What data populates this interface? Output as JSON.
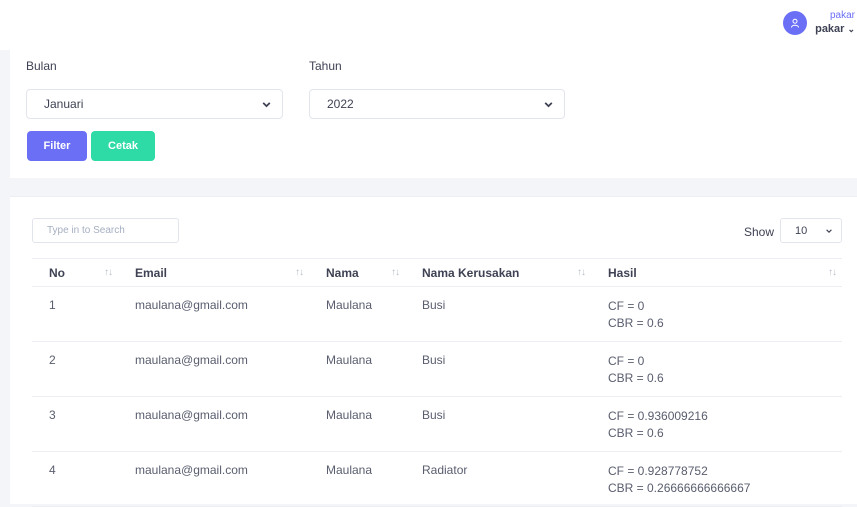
{
  "user": {
    "role": "pakar",
    "name": "pakar"
  },
  "filter": {
    "bulan_label": "Bulan",
    "bulan_value": "Januari",
    "tahun_label": "Tahun",
    "tahun_value": "2022",
    "filter_button": "Filter",
    "cetak_button": "Cetak"
  },
  "table_controls": {
    "search_placeholder": "Type in to Search",
    "show_label": "Show",
    "page_length": "10"
  },
  "table": {
    "headers": [
      "No",
      "Email",
      "Nama",
      "Nama Kerusakan",
      "Hasil"
    ],
    "rows": [
      {
        "no": "1",
        "email": "maulana@gmail.com",
        "nama": "Maulana",
        "kerusakan": "Busi",
        "cf": "CF = 0",
        "cbr": "CBR = 0.6"
      },
      {
        "no": "2",
        "email": "maulana@gmail.com",
        "nama": "Maulana",
        "kerusakan": "Busi",
        "cf": "CF = 0",
        "cbr": "CBR = 0.6"
      },
      {
        "no": "3",
        "email": "maulana@gmail.com",
        "nama": "Maulana",
        "kerusakan": "Busi",
        "cf": "CF = 0.936009216",
        "cbr": "CBR = 0.6"
      },
      {
        "no": "4",
        "email": "maulana@gmail.com",
        "nama": "Maulana",
        "kerusakan": "Radiator",
        "cf": "CF = 0.928778752",
        "cbr": "CBR = 0.26666666666667"
      }
    ]
  },
  "colors": {
    "primary": "#6a6ff5",
    "success": "#2edaa6"
  }
}
